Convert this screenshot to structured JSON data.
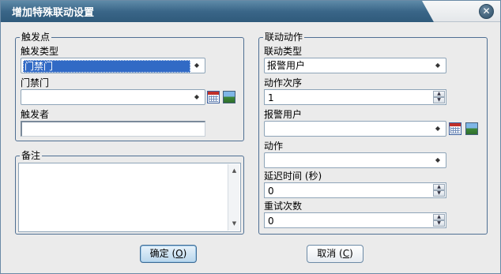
{
  "window": {
    "title": "增加特殊联动设置",
    "close_glyph": "✕"
  },
  "trigger_group": {
    "legend": "触发点",
    "trigger_type_label": "触发类型",
    "trigger_type_value": "门禁门",
    "door_label": "门禁门",
    "door_value": "",
    "trigger_by_label": "触发者",
    "trigger_by_value": ""
  },
  "notes_group": {
    "legend": "备注",
    "value": ""
  },
  "action_group": {
    "legend": "联动动作",
    "link_type_label": "联动类型",
    "link_type_value": "报警用户",
    "order_label": "动作次序",
    "order_value": "1",
    "alarm_user_label": "报警用户",
    "alarm_user_value": "",
    "action_label": "动作",
    "action_value": "",
    "delay_label": "延迟时间 (秒)",
    "delay_value": "0",
    "retry_label": "重试次数",
    "retry_value": "0"
  },
  "buttons": {
    "ok_label": "确定 (",
    "ok_key": "O",
    "ok_tail": ")",
    "cancel_label": "取消 (",
    "cancel_key": "C",
    "cancel_tail": ")"
  },
  "icons": {
    "combo_arrow": "◆",
    "spin_up": "▲",
    "spin_down": "▼",
    "scroll_up": "▲",
    "scroll_down": "▼"
  }
}
